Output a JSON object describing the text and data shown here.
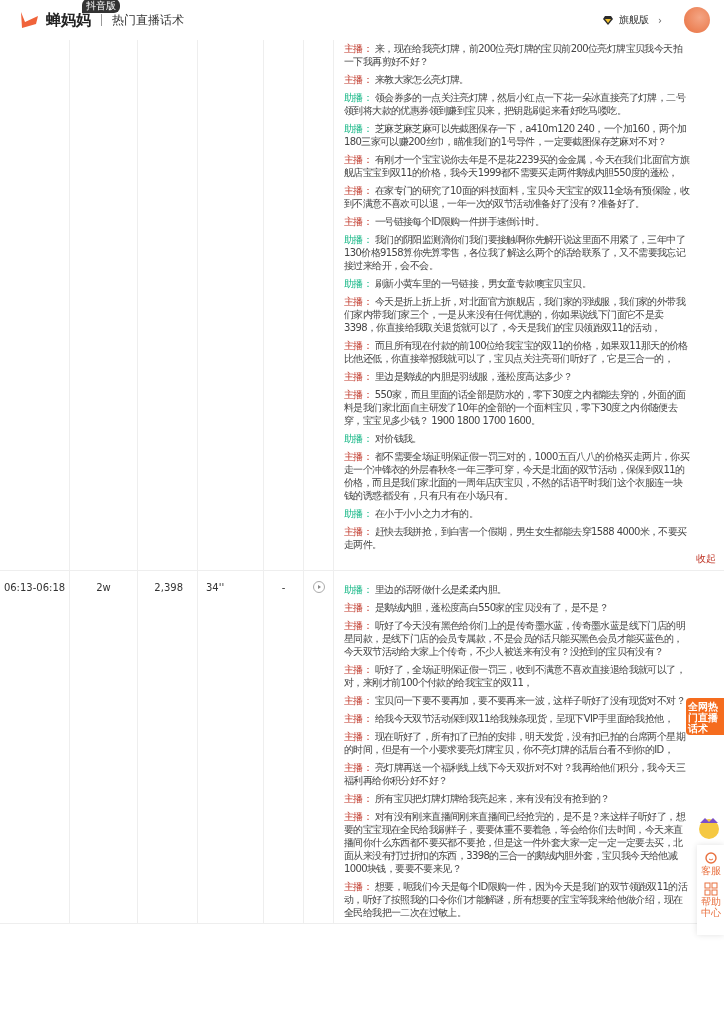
{
  "header": {
    "brand": "蝉妈妈",
    "badge": "抖音版",
    "page_title": "热门直播话术",
    "plan": "旗舰版",
    "plan_caret": "›"
  },
  "rows": [
    {
      "time": "",
      "viewers": "",
      "sales": "",
      "duration": "",
      "column_5": "",
      "has_play": false,
      "collapse": "收起",
      "lines": [
        {
          "kind": "host",
          "role": "主播：",
          "text": "来，现在给我亮灯牌，前200位亮灯牌的宝贝前200位亮灯牌宝贝我今天拍一下我再剪好不好？"
        },
        {
          "kind": "host",
          "role": "主播：",
          "text": "来教大家怎么亮灯牌。"
        },
        {
          "kind": "assistant",
          "role": "助播：",
          "text": "领会券多的一点关注亮灯牌，然后小红点一下花一朵冰直接亮了灯牌，二号领到将大款的优惠券领到赚到宝贝来，把钥匙刷起来看好吃马喽吃。"
        },
        {
          "kind": "assistant",
          "role": "助播：",
          "text": "芝麻芝麻芝麻可以先截图保存一下，a410m120 240，一个加160，两个加180三家可以赚200丝巾，瞄准我们的1号导件，一定要截图保存芝麻对不对？"
        },
        {
          "kind": "host",
          "role": "主播：",
          "text": "有刚才一个宝宝说你去年是不是花2239买的金金属，今天在我们北面官方旗舰店宝宝到双11的价格，我今天1999都不需要买走两件鹅绒内胆550度的蓬松，"
        },
        {
          "kind": "host",
          "role": "主播：",
          "text": "在家专门的研究了10面的科技面料，宝贝今天宝宝的双11全场有预保险，收到不满意不喜欢可以退，一年一次的双节活动准备好了没有？准备好了。"
        },
        {
          "kind": "host",
          "role": "主播：",
          "text": "一号链接每个ID限购一件拼手速倒计时。"
        },
        {
          "kind": "assistant",
          "role": "助播：",
          "text": "我们的阴阳监测滴你们我们要接触啊你先解开说这里面不用紧了，三年中了130价格9158算你先算零售，各位我了解这么两个的话给联系了，又不需要我忘记接过来给开，会不会。"
        },
        {
          "kind": "assistant",
          "role": "助播：",
          "text": "刷新小黄车里的一号链接，男女童专款噢宝贝宝贝。"
        },
        {
          "kind": "host",
          "role": "主播：",
          "text": "今天是折上折上折，对北面官方旗舰店，我们家的羽绒服，我们家的外带我们家内带我们家三个，一是从来没有任何优惠的，你如果说线下门面它不是卖3398，你直接给我取关退货就可以了，今天是我们的宝贝领跑双11的活动，"
        },
        {
          "kind": "host",
          "role": "主播：",
          "text": "而且所有现在付款的前100位给我宝宝的双11的价格，如果双11那天的价格比他还低，你直接举报我就可以了，宝贝点关注亮哥们听好了，它是三合一的，"
        },
        {
          "kind": "host",
          "role": "主播：",
          "text": "里边是鹅绒的内胆是羽绒服，蓬松度高达多少？"
        },
        {
          "kind": "host",
          "role": "主播：",
          "text": "550家，而且里面的话全部是防水的，零下30度之内都能去穿的，外面的面料是我们家北面自主研发了10年的全部的一个面料宝贝，零下30度之内你随便去穿，宝宝见多少钱？ 1900 1800 1700 1600。"
        },
        {
          "kind": "assistant",
          "role": "助播：",
          "text": "对价钱我。"
        },
        {
          "kind": "host",
          "role": "主播：",
          "text": "都不需要全场证明保证假一罚三对的，1000五百八八的价格买走两片，你买走一个冲锋衣的外层春秋冬一年三季可穿，今天是北面的双节活动，保保到双11的价格，而且是我们家北面的一周年店庆宝贝，不然的话语平时我们这个衣服连一块钱的诱惑都没有，只有只有在小场只有。"
        },
        {
          "kind": "assistant",
          "role": "助播：",
          "text": "在小于小小之力才有的。"
        },
        {
          "kind": "host",
          "role": "主播：",
          "text": "赶快去我拼抢，到白害一个假期，男生女生都能去穿1588 4000米，不要买走两件。"
        }
      ]
    },
    {
      "time": "06:13-06:18",
      "viewers": "2w",
      "sales": "2,398",
      "duration": "34''",
      "column_5": "-",
      "has_play": true,
      "collapse": "",
      "lines": [
        {
          "kind": "assistant",
          "role": "助播：",
          "text": "里边的话呀做什么是柔柔内胆。"
        },
        {
          "kind": "host",
          "role": "主播：",
          "text": "是鹅绒内胆，蓬松度高白550家的宝贝没有了，是不是？"
        },
        {
          "kind": "host",
          "role": "主播：",
          "text": "听好了今天没有黑色给你们上的是传奇墨水蓝，传奇墨水蓝是线下门店的明星同款，是线下门店的会员专属款，不是会员的话只能买黑色会员才能买蓝色的，今天双节活动给大家上个传奇，不少人被送来有没有？没抢到的宝贝有没有？"
        },
        {
          "kind": "host",
          "role": "主播：",
          "text": "听好了，全场证明保证假一罚三，收到不满意不喜欢直接退给我就可以了，对，来刚才前100个付款的给我宝宝的双11，"
        },
        {
          "kind": "host",
          "role": "主播：",
          "text": "宝贝问一下要不要再加，要不要再来一波，这样子听好了没有现货对不对？"
        },
        {
          "kind": "host",
          "role": "主播：",
          "text": "给我今天双节活动保到双11给我辣条现货，呈现下VIP手里面给我抢他，"
        },
        {
          "kind": "host",
          "role": "主播：",
          "text": "现在听好了，所有扣了已拍的安排，明天发货，没有扣已拍的台席两个星期的时间，但是有一个小要求要亮灯牌宝贝，你不亮灯牌的话后台看不到你的ID，"
        },
        {
          "kind": "host",
          "role": "主播：",
          "text": "亮灯牌再送一个福利线上线下今天双折对不对？我再给他们积分，我今天三福利再给你积分好不好？"
        },
        {
          "kind": "host",
          "role": "主播：",
          "text": "所有宝贝把灯牌灯牌给我亮起来，来有没有没有抢到的？"
        },
        {
          "kind": "host",
          "role": "主播：",
          "text": "对有没有刚来直播间刚来直播间已经抢完的，是不是？来这样子听好了，想要的宝宝现在全民给我刷样子，要要体重不要着急，等会给你们去时间，今天来直播间你什么东西都不要买都不要抢，但是这一件外套大家一定一定一定要去买，北面从来没有打过折扣的东西，3398的三合一的鹅绒内胆外套，宝贝我今天给他减1000块钱，要要不要来见？"
        },
        {
          "kind": "host",
          "role": "主播：",
          "text": "想要，呃我们今天是每个ID限购一件，因为今天是我们的双节领跑双11的活动，听好了按照我的口令你们才能解谜，所有想要的宝宝等我来给他做介绍，现在全民给我把一二次在过敏上。"
        }
      ]
    }
  ],
  "float_card": {
    "title": "全网热门直播话术"
  },
  "side_panel": {
    "items": [
      {
        "kind": "service",
        "label": "客服"
      },
      {
        "kind": "help",
        "label": "帮助中心"
      }
    ]
  }
}
